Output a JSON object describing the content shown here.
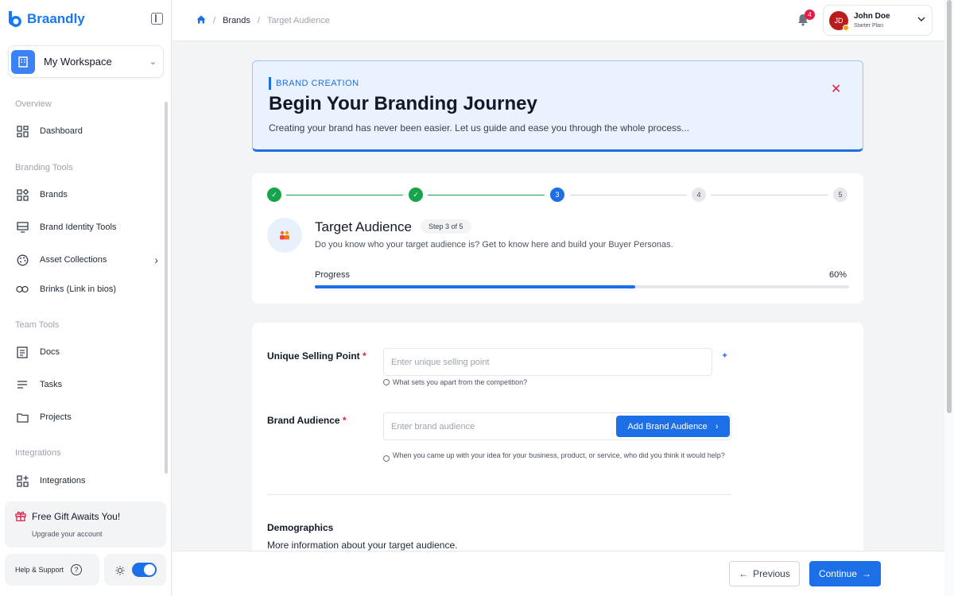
{
  "app": {
    "brand_name": "Braandly",
    "accent": "#1d6fe8"
  },
  "sidebar": {
    "workspace": "My Workspace",
    "sections": {
      "overview": "Overview",
      "branding": "Branding Tools",
      "team": "Team Tools",
      "integrations": "Integrations"
    },
    "items": {
      "dashboard": "Dashboard",
      "brands": "Brands",
      "identity": "Brand Identity Tools",
      "assets": "Asset Collections",
      "brinks": "Brinks (Link in bios)",
      "docs": "Docs",
      "tasks": "Tasks",
      "projects": "Projects",
      "integrations": "Integrations"
    },
    "gift": {
      "title": "Free Gift Awaits You!",
      "subtitle": "Upgrade your account"
    },
    "help": "Help & Support",
    "theme_toggle": "on"
  },
  "header": {
    "breadcrumb": {
      "brands": "Brands",
      "current": "Target Audience"
    },
    "notifications": "4",
    "user": {
      "initials": "JD",
      "name": "John Doe",
      "plan": "Starter Plan"
    }
  },
  "banner": {
    "tag": "BRAND CREATION",
    "title": "Begin Your Branding Journey",
    "description": "Creating your brand has never been easier. Let us guide and ease you through the whole process..."
  },
  "steps": {
    "items": [
      {
        "label": "1",
        "state": "done"
      },
      {
        "label": "2",
        "state": "done"
      },
      {
        "label": "3",
        "state": "active"
      },
      {
        "label": "4",
        "state": "todo"
      },
      {
        "label": "5",
        "state": "todo"
      }
    ],
    "title": "Target Audience",
    "pill": "Step 3 of 5",
    "description": "Do you know who your target audience is? Get to know here and build your Buyer Personas.",
    "progress_label": "Progress",
    "progress_text": "60%",
    "progress": 0.6
  },
  "form": {
    "usp": {
      "label": "Unique Selling Point",
      "placeholder": "Enter unique selling point",
      "hint": "What sets you apart from the competition?"
    },
    "audience": {
      "label": "Brand Audience",
      "placeholder": "Enter brand audience",
      "button": "Add Brand Audience",
      "hint": "When you came up with your idea for your business, product, or service, who did you think it would help?"
    },
    "demographics": {
      "title": "Demographics",
      "description": "More information about your target audience."
    }
  },
  "footer": {
    "previous": "Previous",
    "continue": "Continue"
  }
}
